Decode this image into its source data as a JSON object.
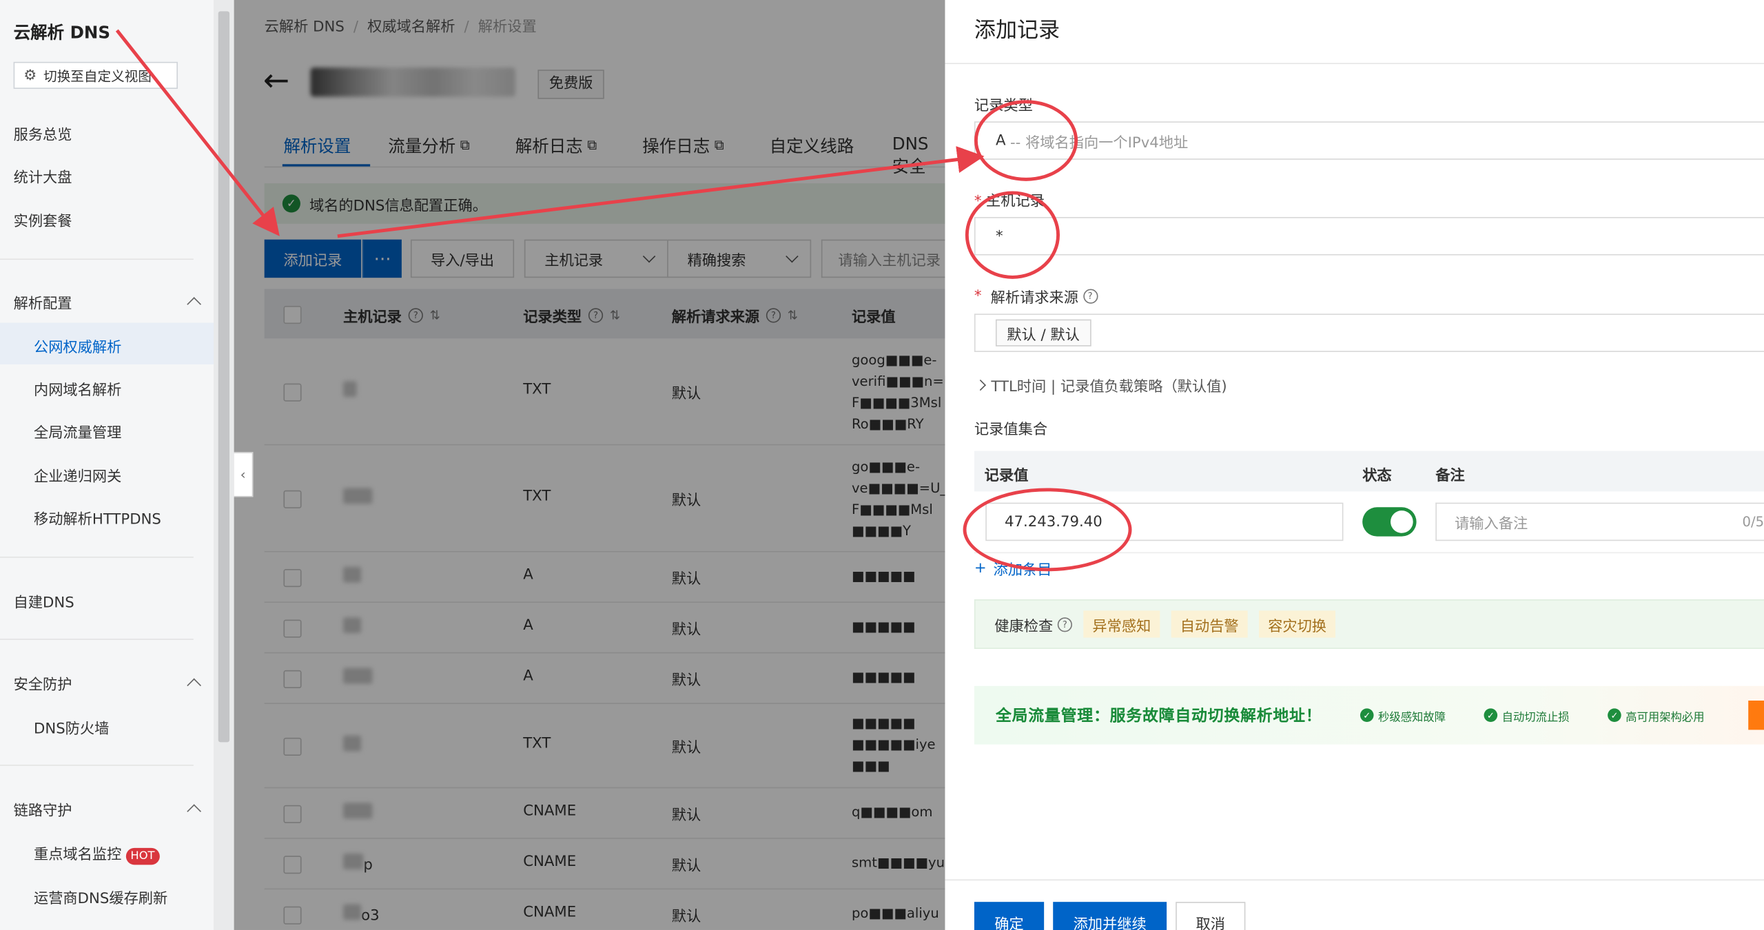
{
  "sidebar": {
    "logo": "云解析 DNS",
    "switch_view": "切换至自定义视图",
    "items": {
      "overview": "服务总览",
      "stats": "统计大盘",
      "instances": "实例套餐",
      "resolution_config": "解析配置",
      "public_authoritative": "公网权威解析",
      "private_resolution": "内网域名解析",
      "gtm": "全局流量管理",
      "recursive_gateway": "企业递归网关",
      "httpdns": "移动解析HTTPDNS",
      "self_dns": "自建DNS",
      "security": "安全防护",
      "dns_firewall": "DNS防火墙",
      "link_guard": "链路守护",
      "key_domain_monitor": "重点域名监控",
      "hot_badge": "HOT",
      "isp_cache_refresh": "运营商DNS缓存刷新"
    }
  },
  "breadcrumb": [
    "云解析 DNS",
    "权威域名解析",
    "解析设置"
  ],
  "edition": "免费版",
  "tabs": [
    "解析设置",
    "流量分析",
    "解析日志",
    "操作日志",
    "自定义线路",
    "DNS安全"
  ],
  "notice": "域名的DNS信息配置正确。",
  "toolbar": {
    "add_record": "添加记录",
    "more": "···",
    "import_export": "导入/导出",
    "host_filter": "主机记录",
    "exact_search": "精确搜索",
    "search_placeholder": "请输入主机记录"
  },
  "table": {
    "headers": [
      "主机记录",
      "记录类型",
      "解析请求来源",
      "记录值"
    ],
    "rows": [
      {
        "type": "TXT",
        "source": "默认",
        "value_lines": [
          "goog■■■e-",
          "verifi■■■n=U_",
          "F■■■■3Msl",
          "Ro■■■RY"
        ]
      },
      {
        "type": "TXT",
        "source": "默认",
        "value_lines": [
          "go■■■e-",
          "ve■■■■=U_",
          "F■■■■Msl",
          "■■■■Y"
        ]
      },
      {
        "type": "A",
        "source": "默认",
        "value_lines": [
          "■■■■■"
        ]
      },
      {
        "type": "A",
        "source": "默认",
        "value_lines": [
          "■■■■■"
        ]
      },
      {
        "type": "A",
        "source": "默认",
        "value_lines": [
          "■■■■■"
        ]
      },
      {
        "type": "TXT",
        "source": "默认",
        "value_lines": [
          "■■■■■",
          "■■■■■iye",
          "■■■"
        ]
      },
      {
        "type": "CNAME",
        "source": "默认",
        "value_lines": [
          "q■■■■om"
        ]
      },
      {
        "type": "CNAME",
        "source": "默认",
        "value_lines": [
          "smt■■■■yu"
        ]
      },
      {
        "type": "CNAME",
        "source": "默认",
        "value_lines": [
          "po■■■aliyu"
        ]
      }
    ],
    "host_suffixes": [
      "",
      "",
      "",
      "",
      "",
      "",
      "",
      "p",
      "o3"
    ]
  },
  "drawer": {
    "title": "添加记录",
    "record_type_label": "记录类型",
    "record_type_value": "A",
    "record_type_desc": "-- 将域名指向一个IPv4地址",
    "host_label": "主机记录",
    "host_value": "*",
    "source_label": "解析请求来源",
    "source_value": "默认 / 默认",
    "ttl_text": "TTL时间 | 记录值负载策略（默认值)",
    "record_set_label": "记录值集合",
    "col_value": "记录值",
    "col_status": "状态",
    "col_note": "备注",
    "record_value": "47.243.79.40",
    "note_placeholder": "请输入备注",
    "note_count": "0/5",
    "add_item": "添加条目",
    "health_label": "健康检查",
    "health_tags": [
      "异常感知",
      "自动告警",
      "容灾切换"
    ],
    "promo_title": "全局流量管理：服务故障自动切换解析地址！",
    "promo_chips": [
      "秒级感知故障",
      "自动切流止损",
      "高可用架构必用"
    ],
    "confirm": "确定",
    "add_continue": "添加并继续",
    "cancel": "取消"
  },
  "colors": {
    "primary": "#0064c8",
    "success": "#1e8e3e",
    "annotation": "#e8414a",
    "hot": "#d9363e"
  }
}
